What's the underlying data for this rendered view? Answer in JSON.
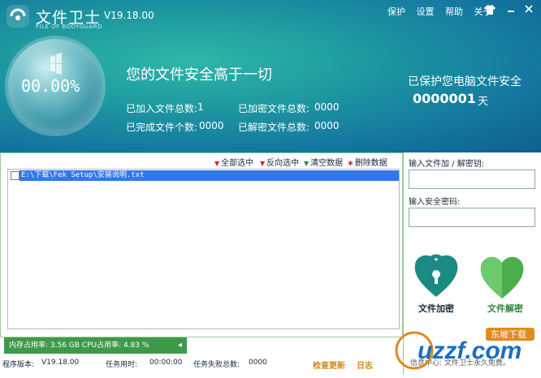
{
  "app": {
    "name": "文件卫士",
    "version": "V19.18.00",
    "subtitle": "FILE OF BODYGUARD"
  },
  "top_menu": [
    "保护",
    "设置",
    "帮助",
    "关于"
  ],
  "progress": {
    "percent_text": "00.00%"
  },
  "tagline": "您的文件安全高于一切",
  "stats": {
    "added_label": "已加入文件总数:",
    "added_value": "1",
    "encrypted_label": "已加密文件总数:",
    "encrypted_value": "0000",
    "completed_label": "已完成文件个数:",
    "completed_value": "0000",
    "decrypted_label": "已解密文件总数:",
    "decrypted_value": "0000"
  },
  "protection": {
    "title": "已保护您电脑文件安全",
    "days": "0000001",
    "unit": "天"
  },
  "toolbar": {
    "select_all": "全部选中",
    "invert": "反向选中",
    "clear": "清空数据",
    "delete": "删除数据"
  },
  "files": [
    {
      "path": "E:\\下载\\Fek Setup\\安装说明.txt",
      "checked": false
    }
  ],
  "right_panel": {
    "key_label": "输入文件加 / 解密钥:",
    "password_label": "输入安全密码:",
    "encrypt_label": "文件加密",
    "decrypt_label": "文件解密"
  },
  "memory": {
    "text": "内存占用率: 3.56 GB  CPU占用率: 4.83 %"
  },
  "statusbar": {
    "version_label": "程序版本:",
    "version_value": "V19.18.00",
    "time_label": "任务用时:",
    "time_value": "00:00:00",
    "fail_label": "任务失败总数:",
    "fail_value": "0000",
    "check_update": "检查更新",
    "log": "日志",
    "info": "信息中心: 文件卫士永久免费。"
  },
  "watermark": {
    "text": "uzzf.com",
    "badge": "东坡下载"
  },
  "colors": {
    "header": "#1e9aa0",
    "accent_green": "#3e9a4a",
    "selection": "#3377ee",
    "shield_dark": "#1a8a83",
    "shield_light": "#6cc96c"
  }
}
